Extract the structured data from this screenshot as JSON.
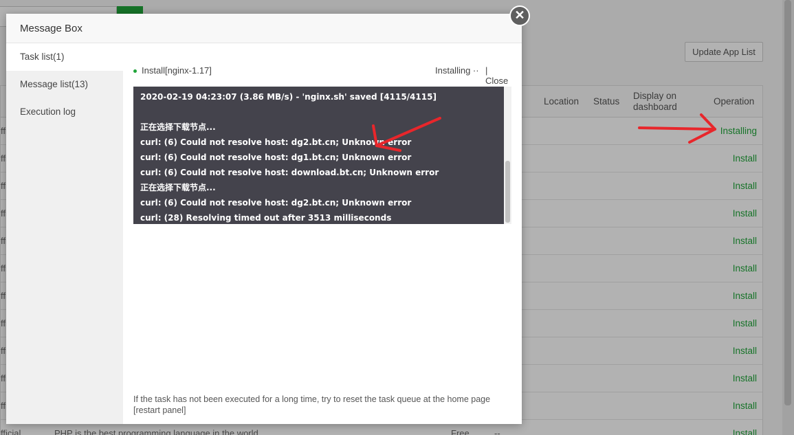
{
  "background": {
    "update_btn": "Update App List",
    "headers": {
      "location": "Location",
      "status": "Status",
      "display": "Display on dashboard",
      "operation": "Operation"
    },
    "rows": [
      {
        "left": "ffici",
        "op": "Installing"
      },
      {
        "left": "ffici",
        "op": "Install"
      },
      {
        "left": "ffici",
        "op": "Install"
      },
      {
        "left": "ffi",
        "op": "Install"
      },
      {
        "left": "ffi",
        "op": "Install"
      },
      {
        "left": "ffi",
        "op": "Install"
      },
      {
        "left": "ffi",
        "op": "Install"
      },
      {
        "left": "ffi",
        "op": "Install"
      },
      {
        "left": "ffi",
        "op": "Install"
      },
      {
        "left": "ffi",
        "op": "Install"
      },
      {
        "left": "ffi",
        "op": "Install"
      }
    ],
    "last_row": {
      "left": "fficial",
      "desc": "PHP is the best programming language in the world",
      "price": "Free",
      "dash": "--",
      "op": "Install"
    }
  },
  "modal": {
    "title": "Message Box",
    "close_glyph": "✕",
    "sidebar": [
      {
        "label": "Task list(1)"
      },
      {
        "label": "Message list(13)"
      },
      {
        "label": "Execution log"
      }
    ],
    "task": {
      "name": "Install[nginx-1.17]",
      "status": "Installing ··",
      "close": "| Close"
    },
    "log": [
      "2020-02-19 04:23:07 (3.86 MB/s) - 'nginx.sh' saved [4115/4115]",
      "",
      "正在选择下载节点...",
      "curl: (6) Could not resolve host: dg2.bt.cn; Unknown error",
      "curl: (6) Could not resolve host: dg1.bt.cn; Unknown error",
      "curl: (6) Could not resolve host: download.bt.cn; Unknown error",
      "正在选择下载节点...",
      "curl: (6) Could not resolve host: dg2.bt.cn; Unknown error",
      "curl: (28) Resolving timed out after 3513 milliseconds"
    ],
    "hint": "If the task has not been executed for a long time, try to reset the task queue at the home page",
    "hint_link": "[restart panel]"
  },
  "colors": {
    "accent_green": "#20a53a",
    "log_bg": "#44434c",
    "annotation_red": "#e8262b"
  }
}
